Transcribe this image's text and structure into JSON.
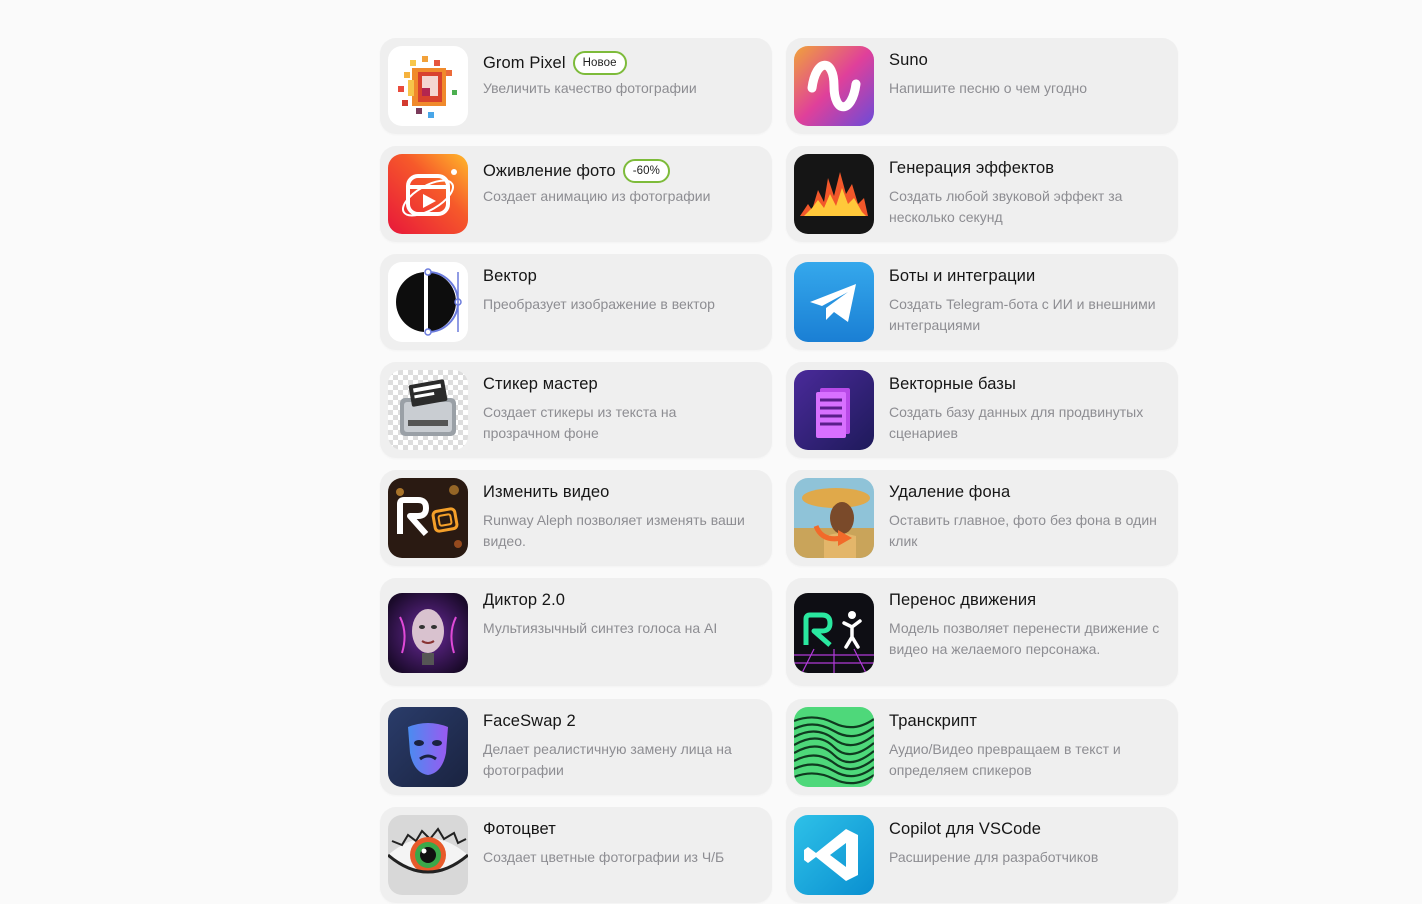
{
  "cards": [
    {
      "title": "Grom Pixel",
      "badge": "Новое",
      "desc": "Увеличить качество фотографии",
      "icon": "pixel-upscale-icon"
    },
    {
      "title": "Suno",
      "badge": "",
      "desc": "Напишите песню о чем угодно",
      "icon": "suno-logo-icon"
    },
    {
      "title": "Оживление фото",
      "badge": "-60%",
      "desc": "Создает анимацию из фотографии",
      "icon": "reels-play-icon"
    },
    {
      "title": "Генерация эффектов",
      "badge": "",
      "desc": "Создать любой звуковой эффект за несколько секунд",
      "icon": "sound-wave-icon"
    },
    {
      "title": "Вектор",
      "badge": "",
      "desc": "Преобразует изображение в вектор",
      "icon": "vector-circle-icon"
    },
    {
      "title": "Боты и интеграции",
      "badge": "",
      "desc": "Создать Telegram-бота с ИИ и внешними интеграциями",
      "icon": "telegram-icon"
    },
    {
      "title": "Стикер мастер",
      "badge": "",
      "desc": "Создает стикеры из текста на прозрачном фоне",
      "icon": "sticker-printer-icon"
    },
    {
      "title": "Векторные базы",
      "badge": "",
      "desc": "Создать базу данных для продвинутых сценариев",
      "icon": "database-book-icon"
    },
    {
      "title": "Изменить видео",
      "badge": "",
      "desc": "Runway Aleph позволяет изменять ваши видео.",
      "icon": "runway-video-icon"
    },
    {
      "title": "Удаление фона",
      "badge": "",
      "desc": "Оставить главное, фото без фона в один клик",
      "icon": "background-removal-icon"
    },
    {
      "title": "Диктор 2.0",
      "badge": "",
      "desc": "Мультиязычный синтез голоса на AI",
      "icon": "ai-voice-face-icon"
    },
    {
      "title": "Перенос движения",
      "badge": "",
      "desc": "Модель позволяет перенести движение с видео на желаемого персонажа.",
      "icon": "motion-transfer-icon"
    },
    {
      "title": "FaceSwap 2",
      "badge": "",
      "desc": "Делает реалистичную замену лица на фотографии",
      "icon": "face-swap-mask-icon"
    },
    {
      "title": "Транскрипт",
      "badge": "",
      "desc": "Аудио/Видео превращаем в текст и определяем спикеров",
      "icon": "transcript-wave-icon"
    },
    {
      "title": "Фотоцвет",
      "badge": "",
      "desc": "Создает цветные фотографии из Ч/Б",
      "icon": "colorized-eye-icon"
    },
    {
      "title": "Copilot для VSCode",
      "badge": "",
      "desc": "Расширение для разработчиков",
      "icon": "vscode-icon"
    }
  ]
}
